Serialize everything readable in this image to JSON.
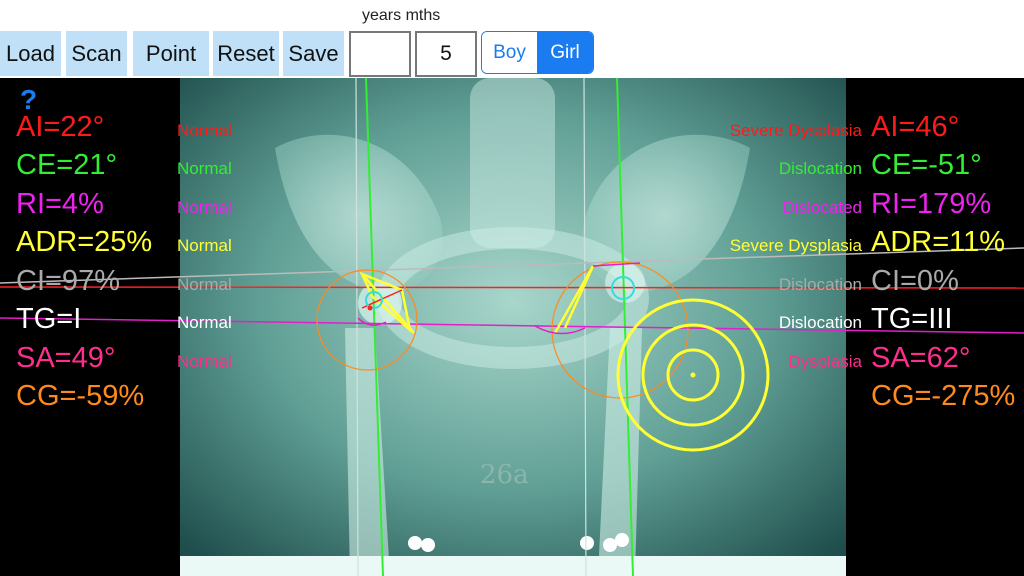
{
  "toolbar": {
    "buttons": [
      {
        "label": "Load"
      },
      {
        "label": "Scan"
      },
      {
        "label": "Point"
      },
      {
        "label": "Reset"
      },
      {
        "label": "Save"
      }
    ],
    "age_label": "years mths",
    "years_value": "",
    "months_value": "5",
    "gender": {
      "boy": "Boy",
      "girl": "Girl",
      "selected": "Girl"
    }
  },
  "help_icon": "?",
  "colors": {
    "AI": "#ff1a1a",
    "CE": "#33ee33",
    "RI": "#ee22ee",
    "ADR": "#ffff33",
    "CI": "#aaaaaa",
    "TG": "#ffffff",
    "SA": "#ff2d8c",
    "CG": "#ff8a1c",
    "accent": "#1a7cf0",
    "toolbar_button": "#bfe0f6"
  },
  "left_hip": {
    "AI": {
      "value": "AI=22°",
      "status": "Normal"
    },
    "CE": {
      "value": "CE=21°",
      "status": "Normal"
    },
    "RI": {
      "value": "RI=4%",
      "status": "Normal"
    },
    "ADR": {
      "value": "ADR=25%",
      "status": "Normal"
    },
    "CI": {
      "value": "CI=97%",
      "status": "Normal"
    },
    "TG": {
      "value": "TG=I",
      "status": "Normal"
    },
    "SA": {
      "value": "SA=49°",
      "status": "Normal"
    },
    "CG": {
      "value": "CG=-59%"
    }
  },
  "right_hip": {
    "AI": {
      "value": "AI=46°",
      "status": "Severe Dysplasia"
    },
    "CE": {
      "value": "CE=-51°",
      "status": "Dislocation"
    },
    "RI": {
      "value": "RI=179%",
      "status": "Dislocated"
    },
    "ADR": {
      "value": "ADR=11%",
      "status": "Severe Dysplasia"
    },
    "CI": {
      "value": "CI=0%",
      "status": "Dislocation"
    },
    "TG": {
      "value": "TG=III",
      "status": "Dislocation"
    },
    "SA": {
      "value": "SA=62°",
      "status": "Dysplasia"
    },
    "CG": {
      "value": "CG=-275%"
    }
  },
  "film_marking": "26a"
}
